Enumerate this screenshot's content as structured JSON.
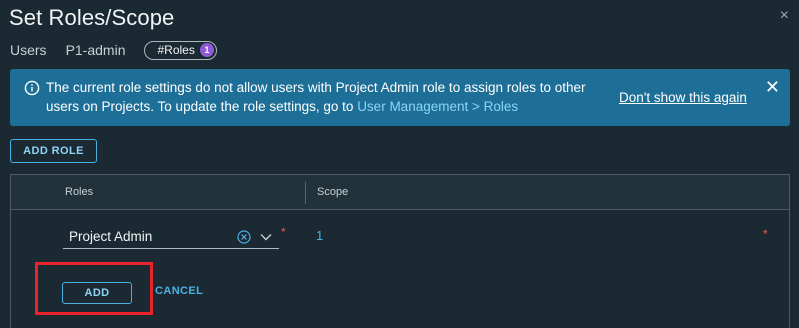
{
  "dialog": {
    "title": "Set Roles/Scope",
    "close_glyph": "×"
  },
  "breadcrumb": {
    "users": "Users",
    "project": "P1-admin",
    "roles_pill": "#Roles",
    "roles_count": "1"
  },
  "banner": {
    "message": "The current role settings do not allow users with Project Admin role to assign roles to other users on Projects. To update the role settings, go to ",
    "link_text": "User Management > Roles",
    "dismiss": "Don't show this again",
    "close_glyph": "✕",
    "icon": "info-icon"
  },
  "toolbar": {
    "add_role_label": "ADD ROLE"
  },
  "table": {
    "columns": [
      "Roles",
      "Scope"
    ],
    "rows": [
      {
        "role": "Project Admin",
        "scope": "1",
        "required_mark": "*"
      }
    ],
    "add_label": "ADD",
    "cancel_label": "CANCEL"
  },
  "colors": {
    "background": "#1b2a32",
    "banner": "#1d6f98",
    "accent": "#49b0e6",
    "badge": "#8d5bd6",
    "required": "#f05a4a",
    "highlight": "#e8232a"
  }
}
